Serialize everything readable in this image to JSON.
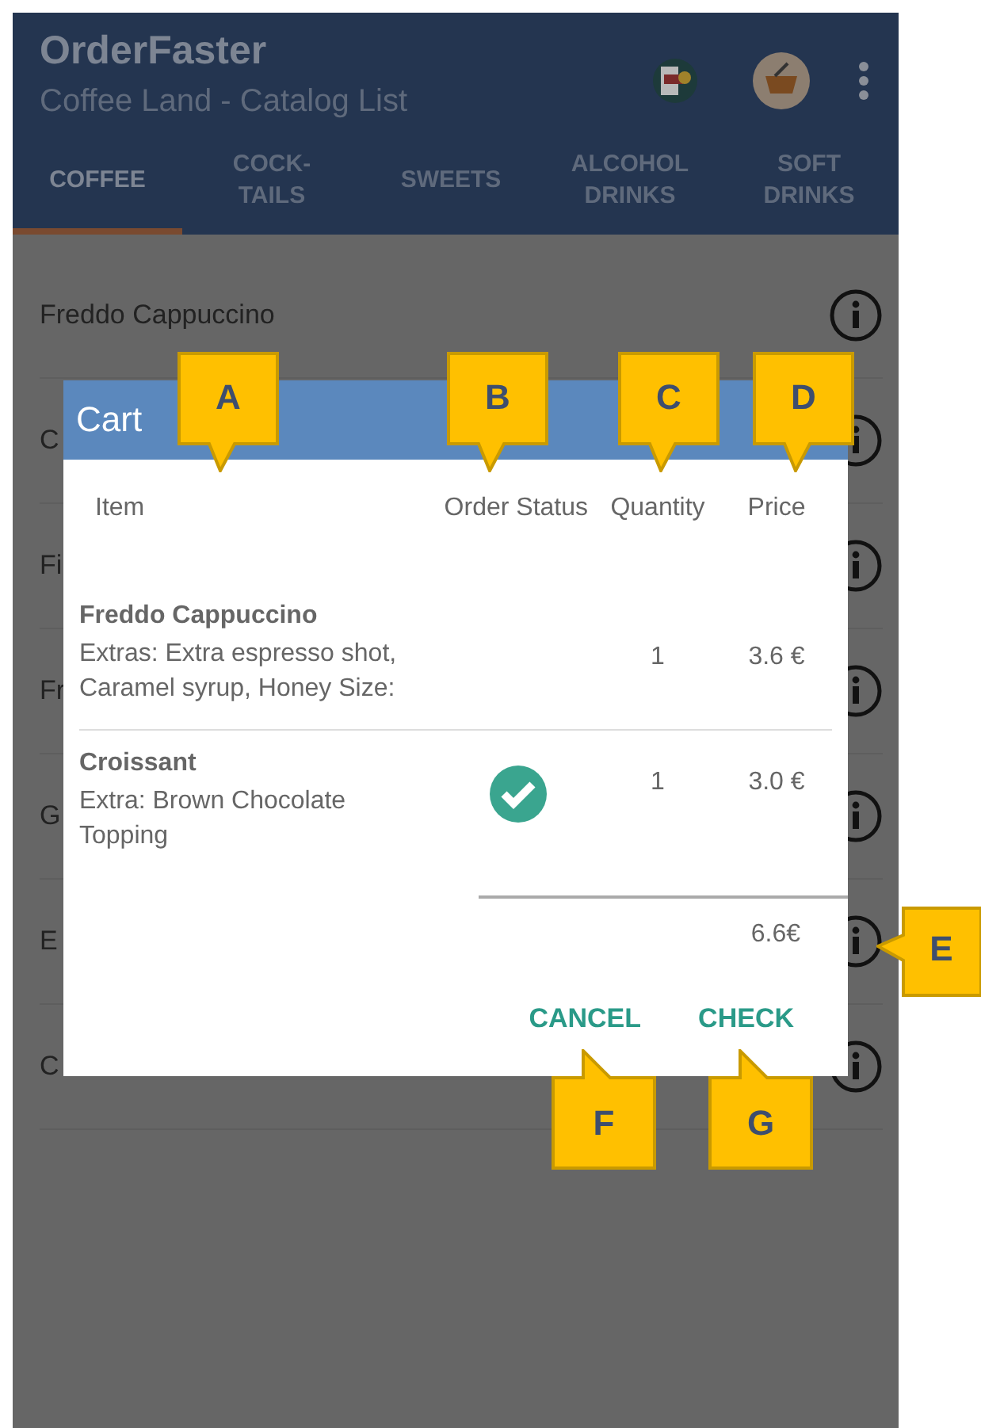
{
  "app_bar": {
    "title": "OrderFaster",
    "subtitle": "Coffee Land - Catalog List"
  },
  "tabs": [
    {
      "label": "COFFEE",
      "selected": true
    },
    {
      "label": "COCK-\nTAILS",
      "selected": false
    },
    {
      "label": "SWEETS",
      "selected": false
    },
    {
      "label": "ALCOHOL\nDRINKS",
      "selected": false
    },
    {
      "label": "SOFT\nDRINKS",
      "selected": false
    }
  ],
  "catalog": [
    {
      "name": "Freddo Cappuccino"
    },
    {
      "name": "C"
    },
    {
      "name": "Fi"
    },
    {
      "name": "Fr"
    },
    {
      "name": "G"
    },
    {
      "name": "E"
    },
    {
      "name": "C"
    }
  ],
  "cart_dialog": {
    "title": "Cart",
    "columns": [
      "Item",
      "Order Status",
      "Quantity",
      "Price"
    ],
    "rows": [
      {
        "name": "Freddo Cappuccino",
        "details": "Extras: Extra espresso shot, Caramel syrup, Honey Size:",
        "status_done": false,
        "quantity": "1",
        "price": "3.6 €"
      },
      {
        "name": "Croissant",
        "details": "Extra: Brown Chocolate Topping",
        "status_done": true,
        "quantity": "1",
        "price": "3.0 €"
      }
    ],
    "total": "6.6€",
    "buttons": [
      "CANCEL",
      "CHECK"
    ]
  },
  "callouts": [
    {
      "label": "A",
      "kind": "down"
    },
    {
      "label": "B",
      "kind": "down"
    },
    {
      "label": "C",
      "kind": "down"
    },
    {
      "label": "D",
      "kind": "down"
    },
    {
      "label": "E",
      "kind": "left"
    },
    {
      "label": "F",
      "kind": "up"
    },
    {
      "label": "G",
      "kind": "up"
    }
  ]
}
